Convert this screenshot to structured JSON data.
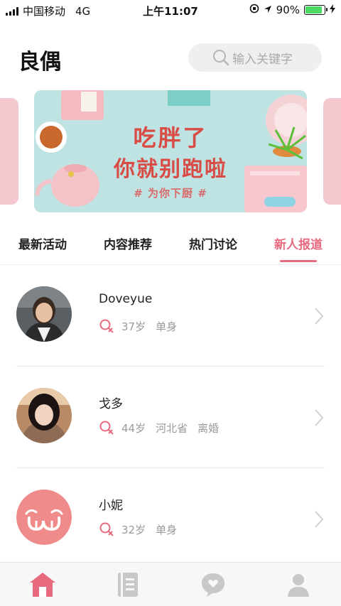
{
  "status_bar": {
    "carrier": "中国移动",
    "network": "4G",
    "time": "上午11:07",
    "battery_text": "90%",
    "battery_level": 0.9
  },
  "header": {
    "title": "良偶",
    "search_placeholder": "输入关键字"
  },
  "banner": {
    "line1": "吃胖了",
    "line2": "你就别跑啦",
    "tag": "# 为你下厨 #"
  },
  "tabs": [
    {
      "label": "最新活动",
      "active": false
    },
    {
      "label": "内容推荐",
      "active": false
    },
    {
      "label": "热门讨论",
      "active": false
    },
    {
      "label": "新人报道",
      "active": true
    }
  ],
  "people": [
    {
      "name": "Doveyue",
      "age": "37岁",
      "province": "",
      "status": "单身",
      "avatar": "photo-avatar"
    },
    {
      "name": "戈多",
      "age": "44岁",
      "province": "河北省",
      "status": "离婚",
      "avatar": "photo-avatar"
    },
    {
      "name": "小妮",
      "age": "32岁",
      "province": "",
      "status": "单身",
      "avatar": "logo-avatar"
    }
  ],
  "bottom_nav": [
    {
      "icon": "home-icon",
      "active": true
    },
    {
      "icon": "notebook-icon",
      "active": false
    },
    {
      "icon": "chat-heart-icon",
      "active": false
    },
    {
      "icon": "user-icon",
      "active": false
    }
  ],
  "colors": {
    "accent": "#e86a7e",
    "banner_text": "#d94b45",
    "inactive_icon": "#c8c8c8"
  }
}
